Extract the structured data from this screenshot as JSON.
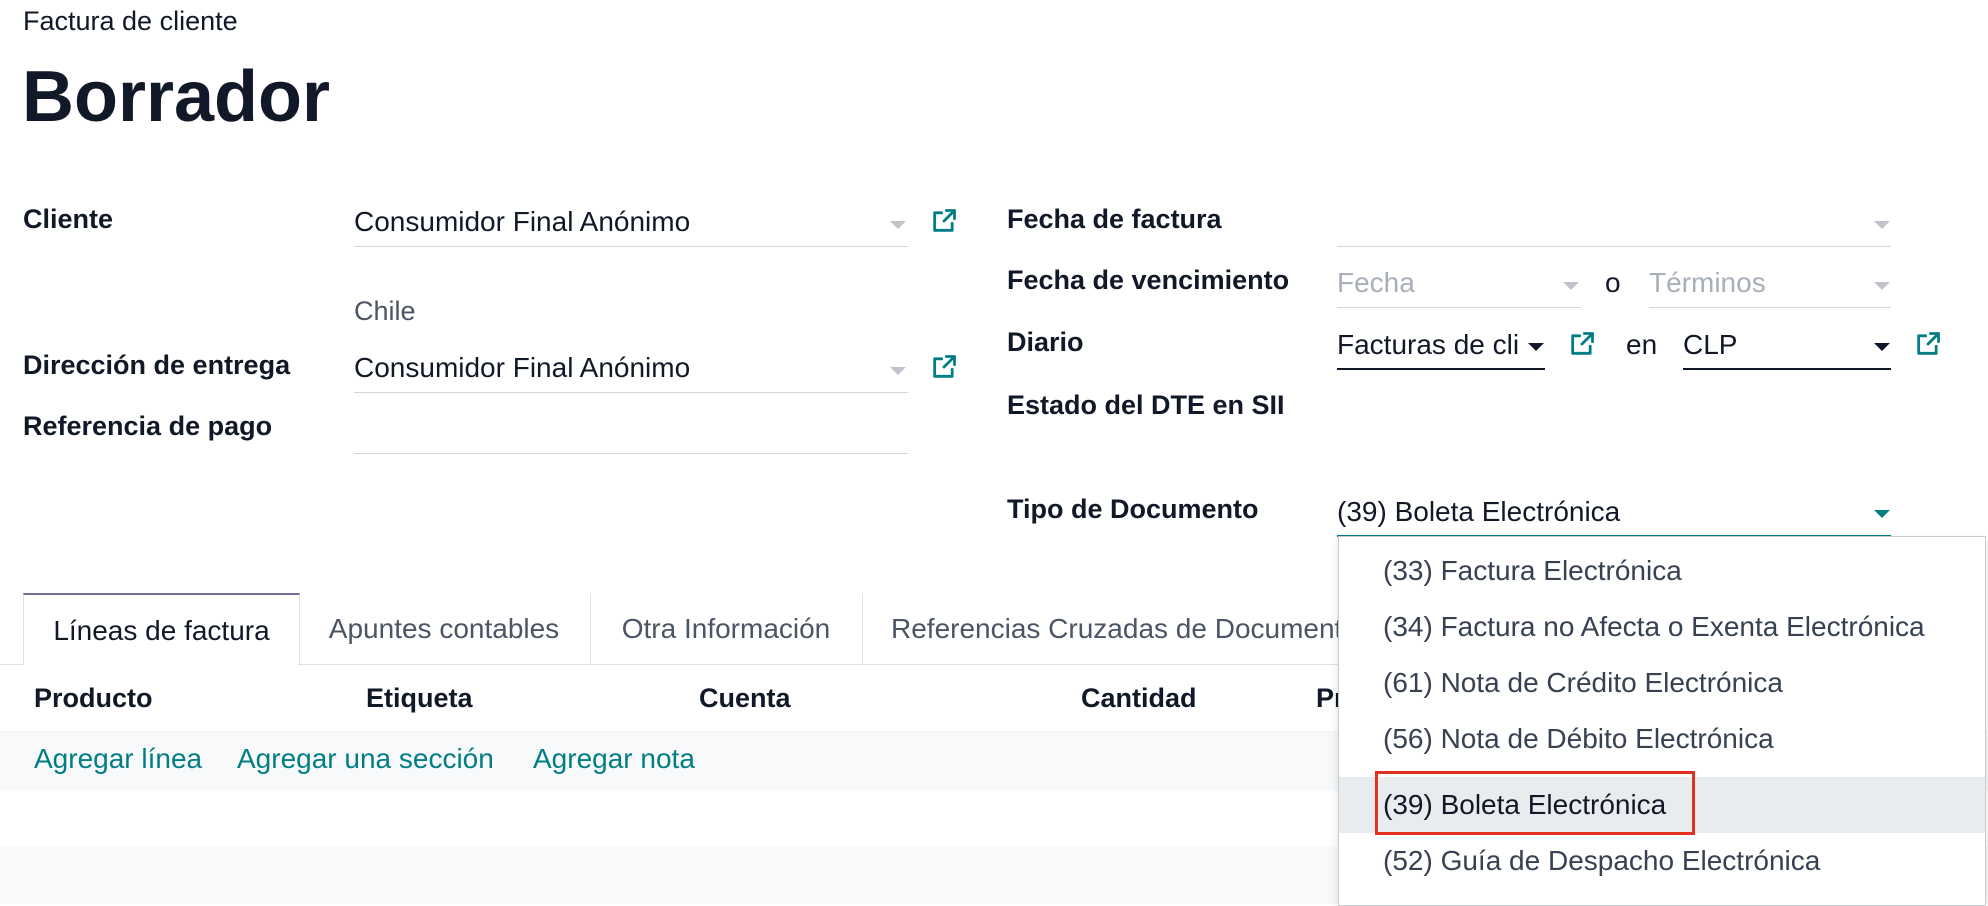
{
  "header": {
    "subtitle": "Factura de cliente",
    "title": "Borrador"
  },
  "form_left": {
    "cliente": {
      "label": "Cliente",
      "value": "Consumidor Final Anónimo",
      "country": "Chile"
    },
    "direccion_entrega": {
      "label": "Dirección de entrega",
      "value": "Consumidor Final Anónimo"
    },
    "referencia_pago": {
      "label": "Referencia de pago",
      "value": ""
    }
  },
  "form_right": {
    "fecha_factura": {
      "label": "Fecha de factura",
      "value": ""
    },
    "fecha_vencimiento": {
      "label": "Fecha de vencimiento",
      "date_placeholder": "Fecha",
      "or_text": "o",
      "terms_placeholder": "Términos"
    },
    "diario": {
      "label": "Diario",
      "value": "Facturas de cli",
      "currency_prefix": "en",
      "currency": "CLP"
    },
    "estado_dte": {
      "label": "Estado del DTE en SII",
      "value": ""
    },
    "tipo_documento": {
      "label": "Tipo de Documento",
      "value": "(39) Boleta Electrónica"
    }
  },
  "tabs": [
    {
      "label": "Líneas de factura",
      "active": true
    },
    {
      "label": "Apuntes contables",
      "active": false
    },
    {
      "label": "Otra Información",
      "active": false
    },
    {
      "label": "Referencias Cruzadas de Document",
      "active": false
    }
  ],
  "table": {
    "columns": [
      "Producto",
      "Etiqueta",
      "Cuenta",
      "Cantidad",
      "Pr"
    ],
    "add_links": [
      "Agregar línea",
      "Agregar una sección",
      "Agregar nota"
    ]
  },
  "dropdown": {
    "selected_index": 4,
    "options": [
      "(33) Factura Electrónica",
      "(34) Factura no Afecta o Exenta Electrónica",
      "(61) Nota de Crédito Electrónica",
      "(56) Nota de Débito Electrónica",
      "(39) Boleta Electrónica",
      "(52) Guía de Despacho Electrónica"
    ]
  },
  "colors": {
    "accent": "#017e84",
    "highlight_box": "#e0321e",
    "tab_active_border": "#7a6a9a"
  },
  "icons": [
    "external-link-icon",
    "caret-down-icon"
  ]
}
